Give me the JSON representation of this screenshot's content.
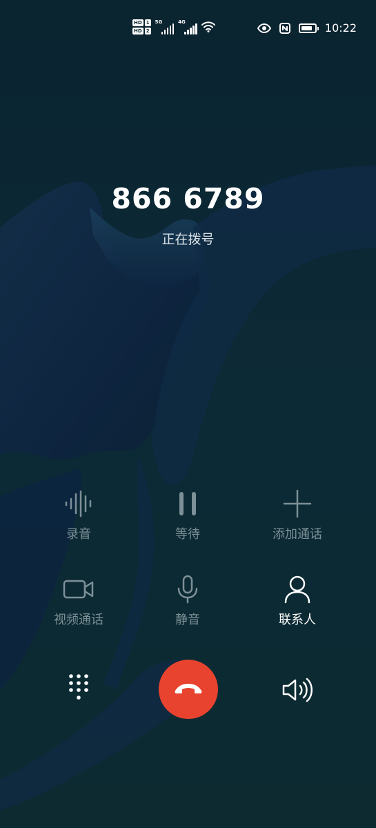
{
  "status_bar": {
    "sim1_hd": "HD",
    "sim1_slot": "1",
    "sim2_hd": "HD",
    "sim2_slot": "2",
    "network1": "5G",
    "network2": "4G",
    "time": "10:22",
    "battery_level": 0.85,
    "icons": [
      "wifi-icon",
      "eye-icon",
      "nfc-icon",
      "battery-icon"
    ]
  },
  "call": {
    "number": "866 6789",
    "status": "正在拨号"
  },
  "controls": {
    "record": {
      "label": "录音",
      "icon": "record-waveform-icon",
      "enabled": false
    },
    "hold": {
      "label": "等待",
      "icon": "pause-icon",
      "enabled": false
    },
    "add_call": {
      "label": "添加通话",
      "icon": "plus-icon",
      "enabled": false
    },
    "video_call": {
      "label": "视频通话",
      "icon": "video-camera-icon",
      "enabled": false
    },
    "mute": {
      "label": "静音",
      "icon": "microphone-icon",
      "enabled": false
    },
    "contacts": {
      "label": "联系人",
      "icon": "person-icon",
      "enabled": true
    }
  },
  "bottom": {
    "dialpad_icon": "dialpad-icon",
    "end_call_icon": "end-call-icon",
    "speaker_icon": "speaker-icon"
  },
  "colors": {
    "end_call": "#e8432f",
    "disabled_text": "#7d9097",
    "background": "#0b2730"
  }
}
